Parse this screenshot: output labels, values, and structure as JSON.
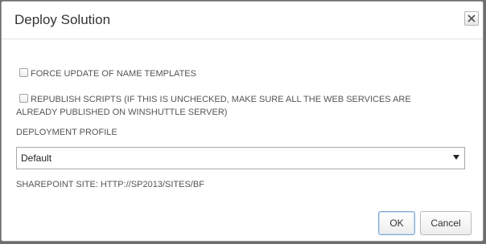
{
  "dialog": {
    "title": "Deploy Solution",
    "close_icon": "close-x-icon"
  },
  "options": {
    "force_update": {
      "label": "FORCE UPDATE OF NAME TEMPLATES",
      "checked": false
    },
    "republish": {
      "label": "REPUBLISH SCRIPTS (IF THIS IS UNCHECKED, MAKE SURE ALL THE WEB SERVICES ARE ALREADY PUBLISHED ON WINSHUTTLE SERVER)",
      "checked": false
    }
  },
  "deployment_profile": {
    "label": "DEPLOYMENT PROFILE",
    "selected": "Default"
  },
  "sharepoint_site": "SHAREPOINT SITE: HTTP://SP2013/SITES/BF",
  "buttons": {
    "ok": "OK",
    "cancel": "Cancel"
  }
}
